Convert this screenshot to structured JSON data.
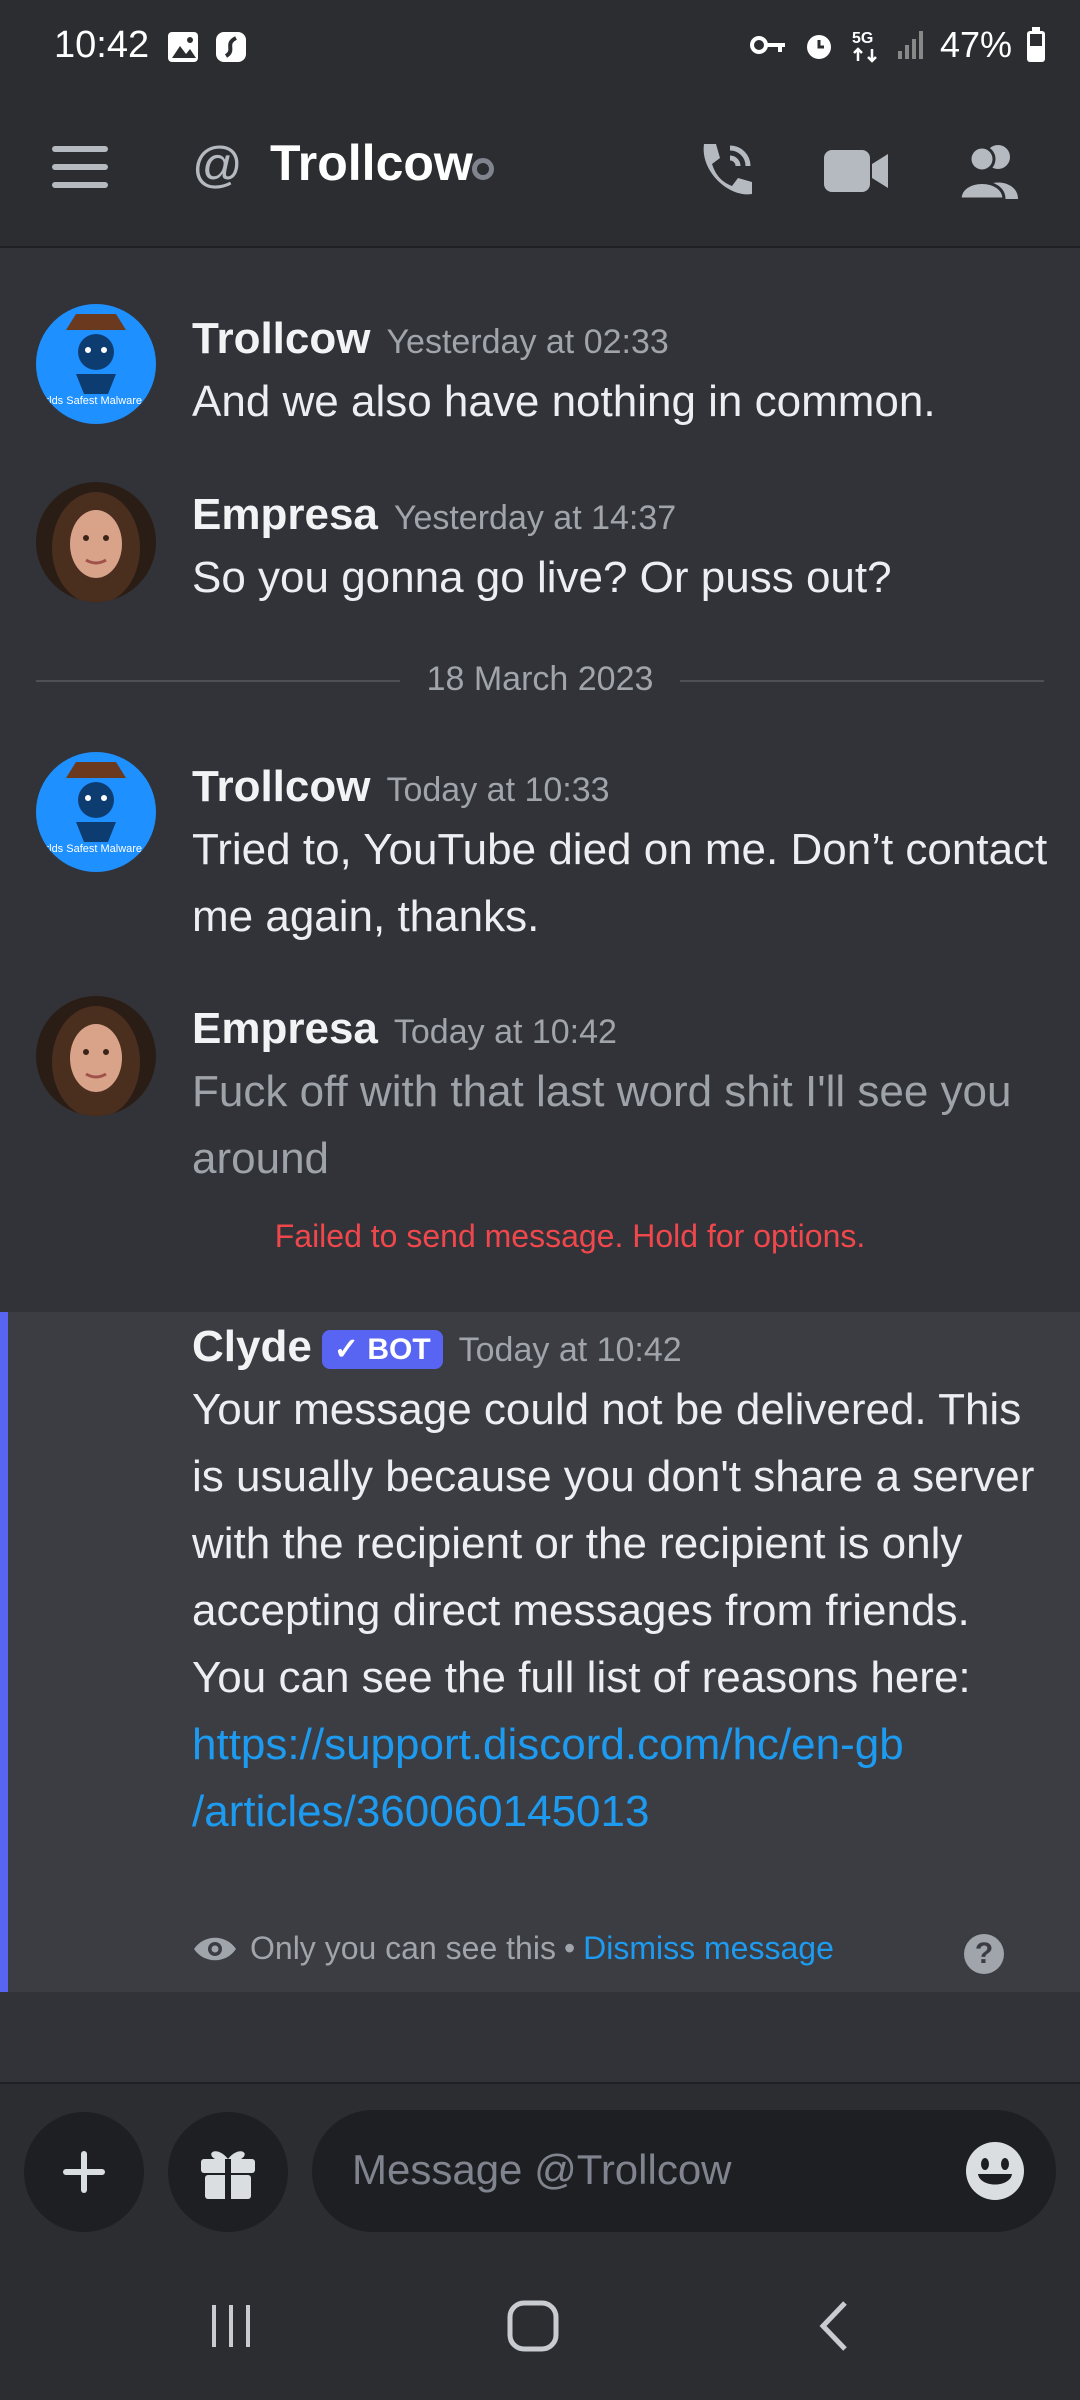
{
  "status_bar": {
    "time": "10:42",
    "battery": "47%",
    "network": "5G"
  },
  "header": {
    "at_symbol": "@",
    "title": "Trollcow"
  },
  "avatars": {
    "trollcow_caption": "Worlds Safest Malware.exe"
  },
  "messages": [
    {
      "author": "Trollcow",
      "timestamp": "Yesterday at 02:33",
      "text": "And we also have nothing in common."
    },
    {
      "author": "Empresa",
      "timestamp": "Yesterday at 14:37",
      "text": "So you gonna go live? Or puss out?"
    },
    {
      "author": "Trollcow",
      "timestamp": "Today at 10:33",
      "text": "Tried to, YouTube died on me. Don’t contact me again, thanks."
    },
    {
      "author": "Empresa",
      "timestamp": "Today at 10:42",
      "text": "Fuck off with that last word shit I'll see you around",
      "error": "Failed to send message. Hold for options."
    }
  ],
  "date_divider": "18 March 2023",
  "clyde": {
    "author": "Clyde",
    "badge": "BOT",
    "timestamp": "Today at 10:42",
    "text": "Your message could not be delivered. This is usually because you don't share a server with the recipient or the recipient is only accepting direct messages from friends. You can see the full list of reasons here:",
    "link_line1": "https://support.discord.com/hc/en-gb",
    "link_line2": "/articles/360060145013",
    "only_you": "Only you can see this",
    "separator": "•",
    "dismiss": "Dismiss message",
    "help": "?"
  },
  "composer": {
    "placeholder": "Message @Trollcow"
  },
  "colors": {
    "background": "#313338",
    "brand": "#5865f2",
    "link": "#1d9bf0",
    "error": "#f0474c",
    "trollcow_avatar": "#1e90ff"
  }
}
